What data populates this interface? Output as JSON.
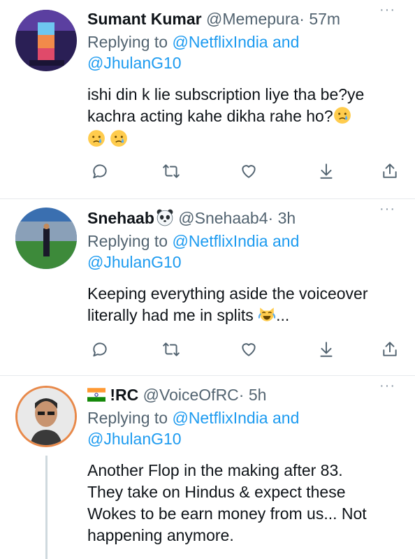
{
  "tweets": [
    {
      "name": "Sumant Kumar",
      "handle": "@Memepura",
      "sep": "·",
      "time": "57m",
      "replying_prefix": "Replying to",
      "replying_to": "@NetflixIndia and",
      "replying_to2": "@JhulanG10",
      "body_line1": "ishi din k lie subscription liye tha be?ye",
      "body_line2": "kachra acting kahe dikha rahe ho?",
      "emojis": [
        "crying-face",
        "crying-face",
        "crying-face"
      ]
    },
    {
      "name": "Snehaab",
      "name_emoji": "panda-face",
      "handle": "@Snehaab4",
      "sep": "·",
      "time": "3h",
      "replying_prefix": "Replying to",
      "replying_to": "@NetflixIndia and",
      "replying_to2": "@JhulanG10",
      "body_line1": "Keeping everything aside the voiceover",
      "body_line2": "literally had me in splits",
      "body_suffix": "...",
      "emojis": [
        "tears-of-joy-cat"
      ]
    },
    {
      "name_prefix_emoji": "india-flag",
      "name": "!RC",
      "handle": "@VoiceOfRC",
      "sep": "·",
      "time": "5h",
      "replying_prefix": "Replying to",
      "replying_to": "@NetflixIndia and",
      "replying_to2": "@JhulanG10",
      "body_line1": "Another Flop in the making after 83.",
      "body_line2": "They take on Hindus & expect these",
      "body_line3": "Wokes to be earn money from us... Not",
      "body_line4": "happening anymore."
    }
  ],
  "more_label": "···",
  "icons": [
    "reply-icon",
    "retweet-icon",
    "like-icon",
    "download-icon",
    "share-icon"
  ],
  "colors": {
    "link": "#1d9bf0",
    "muted": "#536471",
    "icon": "#536471"
  }
}
